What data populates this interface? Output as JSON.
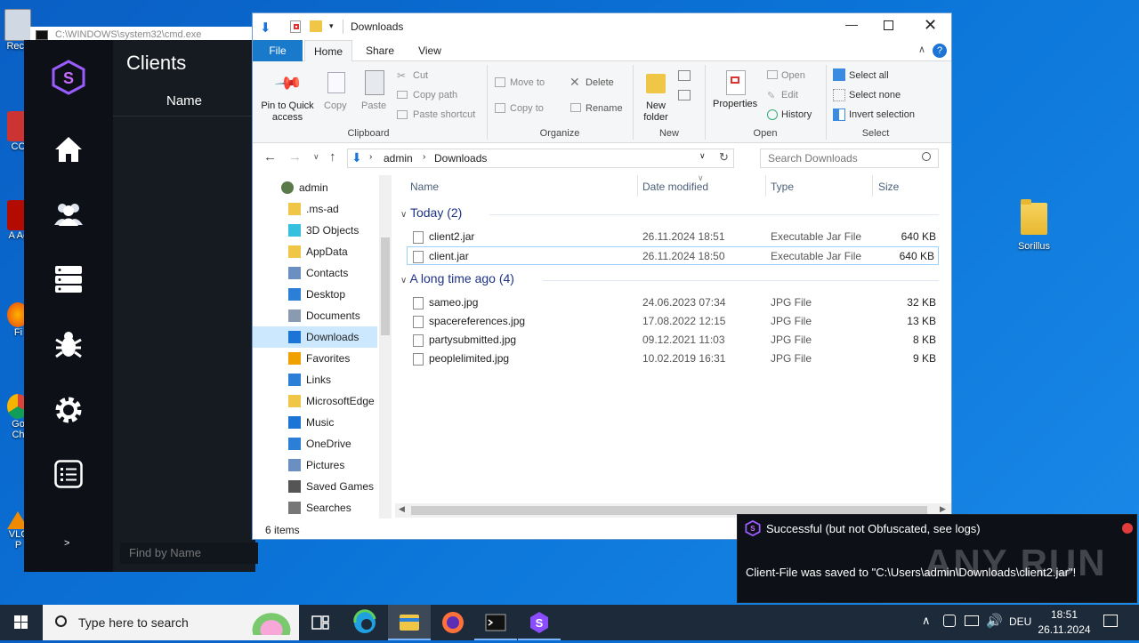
{
  "desktop": {
    "icons": [
      {
        "label": "Recy",
        "name": "recycle-bin"
      },
      {
        "label": "CC",
        "name": "ccleaner"
      },
      {
        "label": "A Ac",
        "name": "acrobat"
      },
      {
        "label": "Fi",
        "name": "firefox"
      },
      {
        "label": "Go Ch",
        "name": "chrome"
      },
      {
        "label": "VLC P",
        "name": "vlc"
      }
    ],
    "folder_label": "Sorillus"
  },
  "cmd": {
    "title": "C:\\WINDOWS\\system32\\cmd.exe"
  },
  "app": {
    "title": "Clients",
    "column_name": "Name",
    "expand_label": ">",
    "find_placeholder": "Find by Name",
    "nav": [
      "home-icon",
      "users-icon",
      "server-icon",
      "bug-icon",
      "gear-icon",
      "list-icon"
    ]
  },
  "explorer": {
    "title": "Downloads",
    "tabs": [
      "File",
      "Home",
      "Share",
      "View"
    ],
    "ribbon": {
      "pin": "Pin to Quick access",
      "copy": "Copy",
      "paste": "Paste",
      "cut": "Cut",
      "copy_path": "Copy path",
      "paste_shortcut": "Paste shortcut",
      "clipboard": "Clipboard",
      "move_to": "Move to",
      "copy_to": "Copy to",
      "delete": "Delete",
      "rename": "Rename",
      "organize": "Organize",
      "new_folder": "New folder",
      "new": "New",
      "properties": "Properties",
      "open": "Open",
      "edit": "Edit",
      "history": "History",
      "open_group": "Open",
      "select_all": "Select all",
      "select_none": "Select none",
      "invert_selection": "Invert selection",
      "select": "Select"
    },
    "address": {
      "path": [
        "admin",
        "Downloads"
      ],
      "search_placeholder": "Search Downloads"
    },
    "nav_items": [
      "admin",
      ".ms-ad",
      "3D Objects",
      "AppData",
      "Contacts",
      "Desktop",
      "Documents",
      "Downloads",
      "Favorites",
      "Links",
      "MicrosoftEdge",
      "Music",
      "OneDrive",
      "Pictures",
      "Saved Games",
      "Searches"
    ],
    "columns": [
      "Name",
      "Date modified",
      "Type",
      "Size"
    ],
    "groups": [
      {
        "label": "Today (2)",
        "files": [
          {
            "name": "client2.jar",
            "date": "26.11.2024 18:51",
            "type": "Executable Jar File",
            "size": "640 KB"
          },
          {
            "name": "client.jar",
            "date": "26.11.2024 18:50",
            "type": "Executable Jar File",
            "size": "640 KB"
          }
        ]
      },
      {
        "label": "A long time ago (4)",
        "files": [
          {
            "name": "sameo.jpg",
            "date": "24.06.2023 07:34",
            "type": "JPG File",
            "size": "32 KB"
          },
          {
            "name": "spacereferences.jpg",
            "date": "17.08.2022 12:15",
            "type": "JPG File",
            "size": "13 KB"
          },
          {
            "name": "partysubmitted.jpg",
            "date": "09.12.2021 11:03",
            "type": "JPG File",
            "size": "8 KB"
          },
          {
            "name": "peoplelimited.jpg",
            "date": "10.02.2019 16:31",
            "type": "JPG File",
            "size": "9 KB"
          }
        ]
      }
    ],
    "status": "6 items"
  },
  "toast": {
    "title": "Successful (but not Obfuscated, see logs)",
    "message": "Client-File was saved to \"C:\\Users\\admin\\Downloads\\client2.jar\"!",
    "watermark": "ANY RUN"
  },
  "taskbar": {
    "search_placeholder": "Type here to search",
    "lang": "DEU",
    "time": "18:51",
    "date": "26.11.2024"
  },
  "colors": {
    "accent": "#0078d7",
    "brand_purple": "#8a4dff",
    "close_red": "#e81123"
  }
}
